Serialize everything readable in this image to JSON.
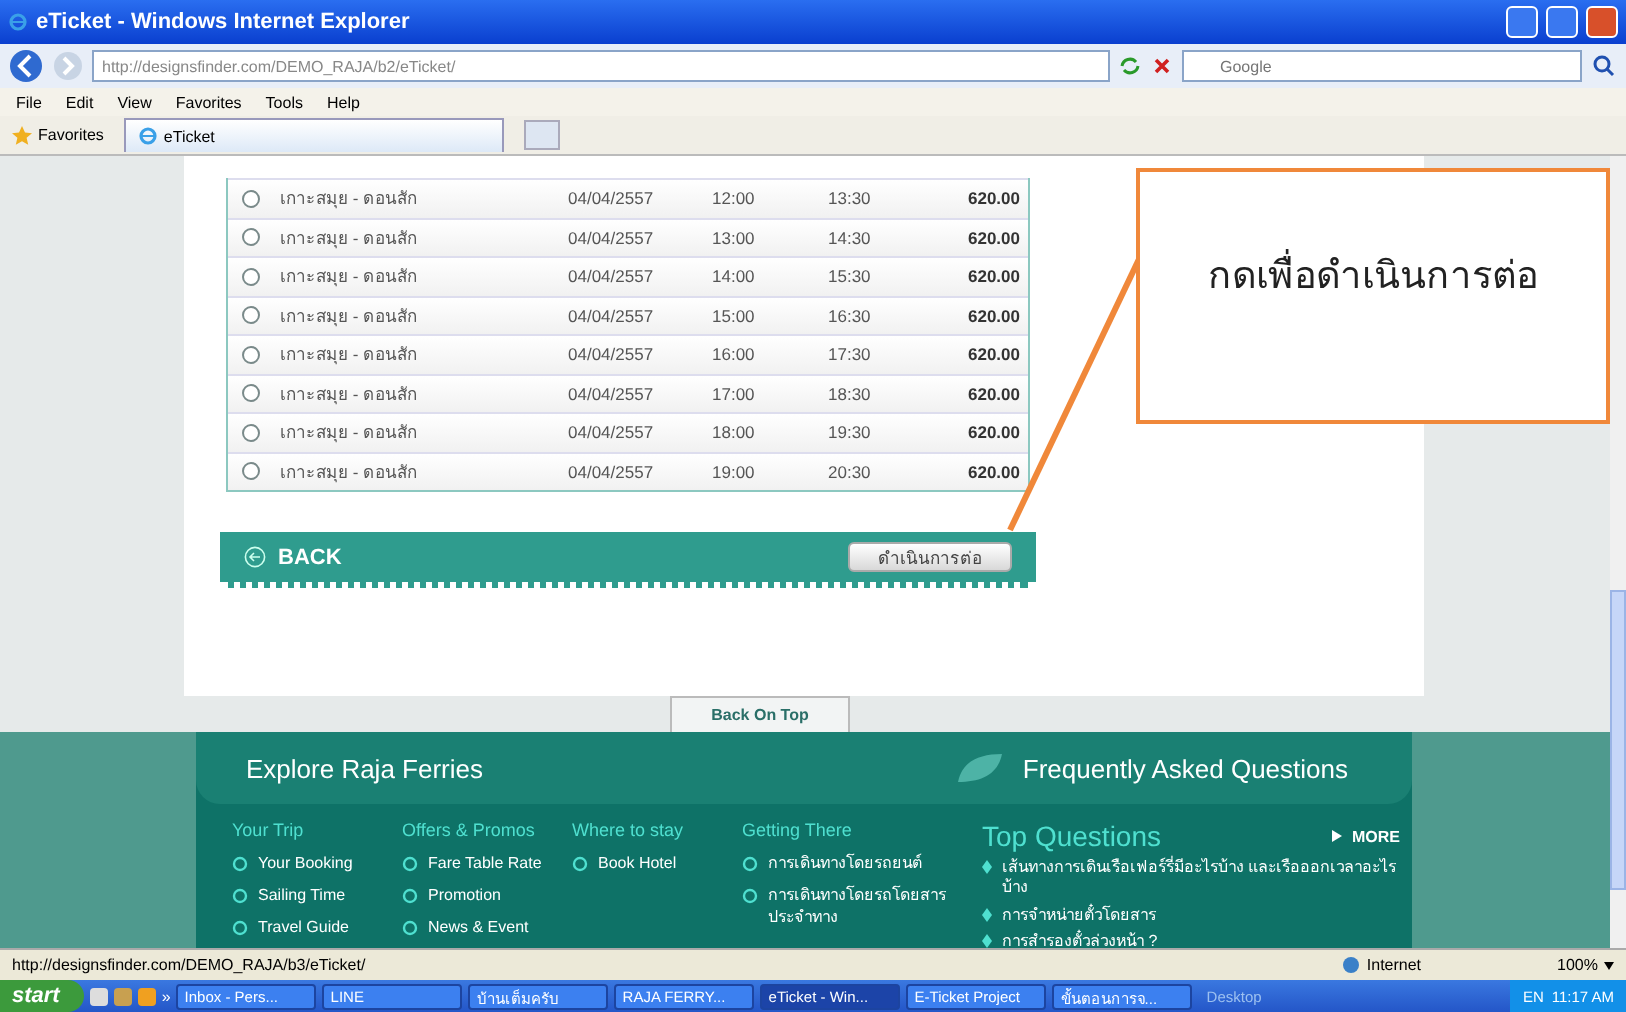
{
  "browser": {
    "title": "eTicket - Windows Internet Explorer",
    "address": "http://designsfinder.com/DEMO_RAJA/b2/eTicket/",
    "search_placeholder": "Google",
    "menu": [
      "File",
      "Edit",
      "View",
      "Favorites",
      "Tools",
      "Help"
    ],
    "favorites_label": "Favorites",
    "tabs": [
      {
        "label": "eTicket",
        "selected": true
      }
    ]
  },
  "trips": {
    "rows": [
      {
        "route": "เกาะสมุย - ดอนสัก",
        "date": "04/04/2557",
        "depart": "12:00",
        "arrive": "13:30",
        "price": "620.00",
        "selected": false
      },
      {
        "route": "เกาะสมุย - ดอนสัก",
        "date": "04/04/2557",
        "depart": "13:00",
        "arrive": "14:30",
        "price": "620.00",
        "selected": false
      },
      {
        "route": "เกาะสมุย - ดอนสัก",
        "date": "04/04/2557",
        "depart": "14:00",
        "arrive": "15:30",
        "price": "620.00",
        "selected": false
      },
      {
        "route": "เกาะสมุย - ดอนสัก",
        "date": "04/04/2557",
        "depart": "15:00",
        "arrive": "16:30",
        "price": "620.00",
        "selected": false
      },
      {
        "route": "เกาะสมุย - ดอนสัก",
        "date": "04/04/2557",
        "depart": "16:00",
        "arrive": "17:30",
        "price": "620.00",
        "selected": false
      },
      {
        "route": "เกาะสมุย - ดอนสัก",
        "date": "04/04/2557",
        "depart": "17:00",
        "arrive": "18:30",
        "price": "620.00",
        "selected": false
      },
      {
        "route": "เกาะสมุย - ดอนสัก",
        "date": "04/04/2557",
        "depart": "18:00",
        "arrive": "19:30",
        "price": "620.00",
        "selected": false
      },
      {
        "route": "เกาะสมุย - ดอนสัก",
        "date": "04/04/2557",
        "depart": "19:00",
        "arrive": "20:30",
        "price": "620.00",
        "selected": false
      }
    ]
  },
  "back_label": "BACK",
  "continue_label": "ดำเนินการต่อ",
  "callout": "กดเพื่อดำเนินการต่อ",
  "back_on_top": "Back On Top",
  "footer": {
    "explore_title": "Explore Raja Ferries",
    "faq_title": "Frequently Asked Questions",
    "columns": [
      {
        "heading": "Your Trip",
        "links": [
          "Your Booking",
          "Sailing Time",
          "Travel Guide"
        ]
      },
      {
        "heading": "Offers & Promos",
        "links": [
          "Fare Table Rate",
          "Promotion",
          "News & Event"
        ]
      },
      {
        "heading": "Where to stay",
        "links": [
          "Book Hotel"
        ]
      },
      {
        "heading": "Getting There",
        "links": [
          "การเดินทางโดยรถยนต์",
          "การเดินทางโดยรถโดยสารประจำทาง"
        ]
      }
    ],
    "top_questions": {
      "title": "Top Questions",
      "more": "MORE",
      "items": [
        "เส้นทางการเดินเรือเฟอร์รี่มีอะไรบ้าง และเรือออกเวลาอะไรบ้าง",
        "การจำหน่ายตั๋วโดยสาร",
        "การสำรองตั๋วล่วงหน้า ?"
      ]
    }
  },
  "status": {
    "url": "http://designsfinder.com/DEMO_RAJA/b3/eTicket/",
    "zone": "Internet",
    "zoom": "100%"
  },
  "taskbar": {
    "start": "start",
    "more": "»",
    "items": [
      {
        "label": "Inbox - Pers...",
        "selected": false
      },
      {
        "label": "LINE",
        "selected": false
      },
      {
        "label": "บ้านเต็มครับ",
        "selected": false
      },
      {
        "label": "RAJA FERRY...",
        "selected": false
      },
      {
        "label": "eTicket - Win...",
        "selected": true
      },
      {
        "label": "E-Ticket Project",
        "selected": false
      },
      {
        "label": "ขั้นตอนการจ...",
        "selected": false
      }
    ],
    "desktop": "Desktop",
    "lang": "EN",
    "clock": "11:17 AM"
  }
}
